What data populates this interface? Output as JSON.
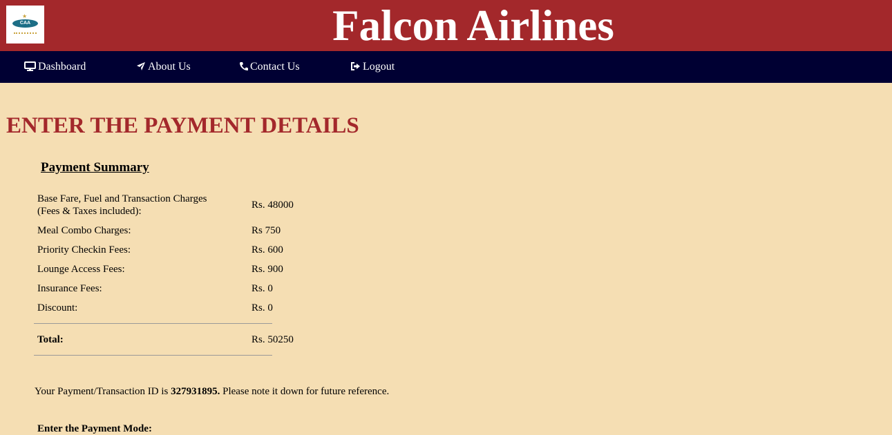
{
  "header": {
    "logo_text": "CAA",
    "site_title": "Falcon Airlines"
  },
  "nav": {
    "items": [
      {
        "label": "Dashboard",
        "icon": "monitor-icon"
      },
      {
        "label": "About Us",
        "icon": "plane-icon"
      },
      {
        "label": "Contact Us",
        "icon": "phone-icon"
      },
      {
        "label": "Logout",
        "icon": "sign-out-icon"
      }
    ]
  },
  "main": {
    "page_title": "ENTER THE PAYMENT DETAILS",
    "summary_title": "Payment Summary",
    "rows": [
      {
        "label_line1": "Base Fare, Fuel and Transaction Charges",
        "label_line2": "(Fees & Taxes included):",
        "value": "Rs. 48000"
      },
      {
        "label": "Meal Combo Charges:",
        "value": "Rs 750"
      },
      {
        "label": "Priority Checkin Fees:",
        "value": "Rs. 600"
      },
      {
        "label": "Lounge Access Fees:",
        "value": "Rs. 900"
      },
      {
        "label": "Insurance Fees:",
        "value": "Rs. 0"
      },
      {
        "label": "Discount:",
        "value": "Rs. 0"
      }
    ],
    "total": {
      "label": "Total:",
      "value": "Rs. 50250"
    },
    "transaction": {
      "prefix": "Your Payment/Transaction ID is",
      "id": "327931895.",
      "suffix": "Please note it down for future reference."
    },
    "payment_mode_label": "Enter the Payment Mode:"
  },
  "colors": {
    "header_bg": "#a3282b",
    "nav_bg": "#000033",
    "page_bg": "#f5deb3",
    "title_color": "#a3282b"
  }
}
